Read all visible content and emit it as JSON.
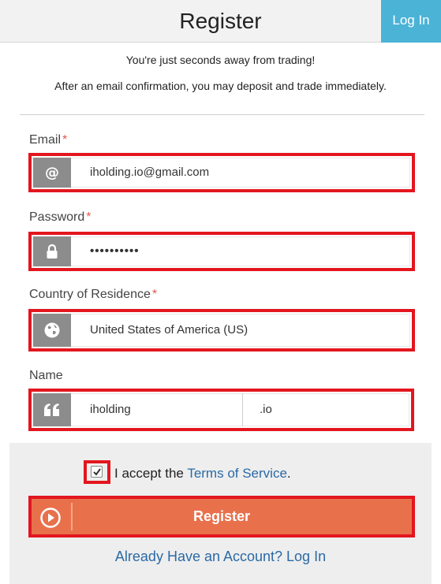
{
  "header": {
    "title": "Register",
    "login_label": "Log In"
  },
  "intro": {
    "line1": "You're just seconds away from trading!",
    "line2": "After an email confirmation, you may deposit and trade immediately."
  },
  "form": {
    "email": {
      "label": "Email",
      "required": "*",
      "value": "iholding.io@gmail.com",
      "icon": "at-icon"
    },
    "password": {
      "label": "Password",
      "required": "*",
      "value": "••••••••••",
      "icon": "lock-icon"
    },
    "country": {
      "label": "Country of Residence",
      "required": "*",
      "value": "United States of America (US)",
      "icon": "globe-icon"
    },
    "name": {
      "label": "Name",
      "first": "iholding",
      "last": ".io",
      "icon": "quote-icon"
    }
  },
  "terms": {
    "checked": true,
    "prefix": "I accept the ",
    "link": "Terms of Service",
    "suffix": "."
  },
  "register_button": {
    "label": "Register"
  },
  "already_link": "Already Have an Account? Log In",
  "colors": {
    "header_bg": "#f2f2f2",
    "login_bg": "#4bb3d6",
    "register_bg": "#e8714c",
    "link": "#2a6aa6",
    "highlight": "#e3161f",
    "icon_bg": "#8c8c8c"
  }
}
